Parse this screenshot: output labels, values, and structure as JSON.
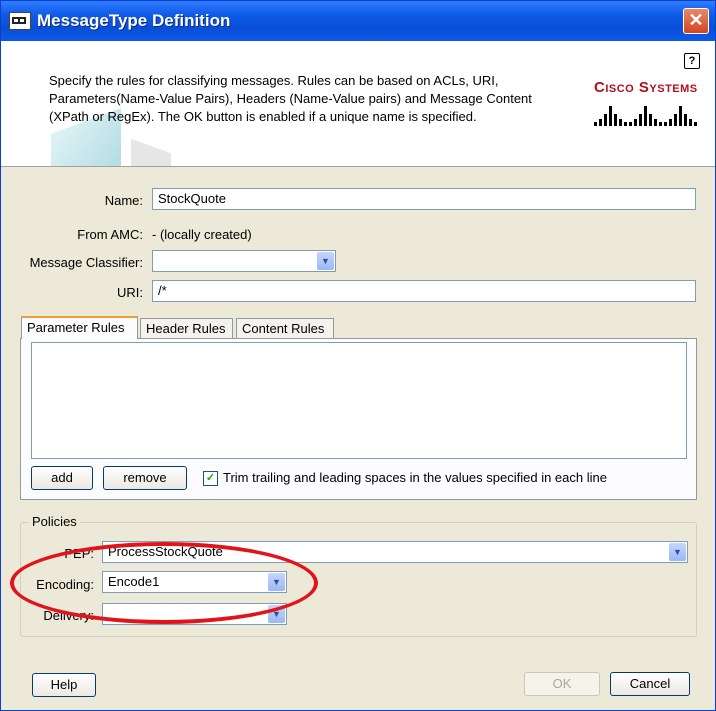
{
  "window": {
    "title": "MessageType Definition",
    "close_glyph": "✕"
  },
  "header": {
    "description": "Specify the rules for classifying messages. Rules can be based on ACLs, URI, Parameters(Name-Value Pairs), Headers (Name-Value pairs) and Message Content (XPath or RegEx). The OK button is enabled if a unique name is specified.",
    "help_glyph": "?",
    "logo_text": "Cisco Systems"
  },
  "form": {
    "name_label": "Name:",
    "name_value": "StockQuote",
    "from_amc_label": "From AMC:",
    "from_amc_value": "- (locally created)",
    "classifier_label": "Message Classifier:",
    "classifier_value": "",
    "uri_label": "URI:",
    "uri_value": "/*"
  },
  "tabs": [
    {
      "label": "Parameter Rules",
      "active": true
    },
    {
      "label": "Header Rules",
      "active": false
    },
    {
      "label": "Content Rules",
      "active": false
    }
  ],
  "rules": {
    "add_label": "add",
    "remove_label": "remove",
    "trim_checked": true,
    "trim_label": "Trim trailing and leading spaces in the values specified in each line"
  },
  "policies": {
    "group_title": "Policies",
    "pep_label": "PEP:",
    "pep_value": "ProcessStockQuote",
    "encoding_label": "Encoding:",
    "encoding_value": "Encode1",
    "delivery_label": "Delivery:",
    "delivery_value": ""
  },
  "footer": {
    "help_label": "Help",
    "ok_label": "OK",
    "cancel_label": "Cancel"
  },
  "colors": {
    "title_bar": "#0a4ed6",
    "accent_highlight": "#e0141a",
    "cisco_red": "#b01020"
  }
}
